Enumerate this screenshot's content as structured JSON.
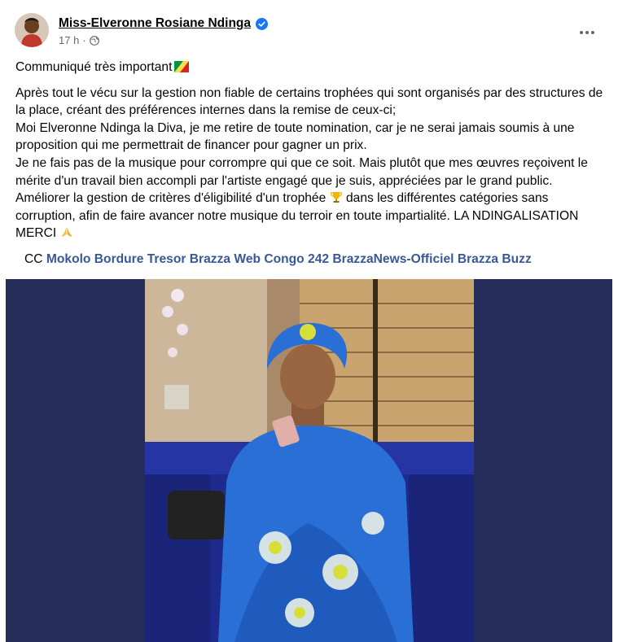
{
  "author": {
    "name": "Miss-Elveronne Rosiane Ndinga",
    "verified_icon": "verified-badge-icon",
    "timestamp": "17 h",
    "audience_icon": "globe-icon"
  },
  "post": {
    "title": "Communiqué très important",
    "paragraphs": [
      "Après tout le vécu sur la gestion non fiable de certains trophées qui sont organisés par des structures de la place, créant des préférences internes dans la remise de ceux-ci;",
      "Moi Elveronne Ndinga la Diva, je me retire de  toute nomination, car je ne serai jamais soumis à une proposition qui me permettrait de financer pour gagner un prix.",
      "Je ne fais pas de la musique pour corrompre qui que ce soit. Mais plutôt que mes œuvres reçoivent le mérite d'un travail bien accompli par l'artiste engagé que je suis, appréciées par le grand public.",
      "Améliorer la gestion de critères d'éligibilité d'un trophée",
      "dans les différentes catégories sans corruption, afin de faire avancer notre musique du terroir en toute impartialité. LA NDINGALISATION MERCI"
    ],
    "cc_prefix": "CC",
    "mentions": [
      "Mokolo Bordure Tresor",
      "Brazza Web Congo 242",
      "BrazzaNews-Officiel",
      "Brazza Buzz"
    ]
  },
  "colors": {
    "link": "#385898",
    "meta": "#65676b",
    "media_bg": "#272d5a",
    "verified": "#1877f2"
  }
}
